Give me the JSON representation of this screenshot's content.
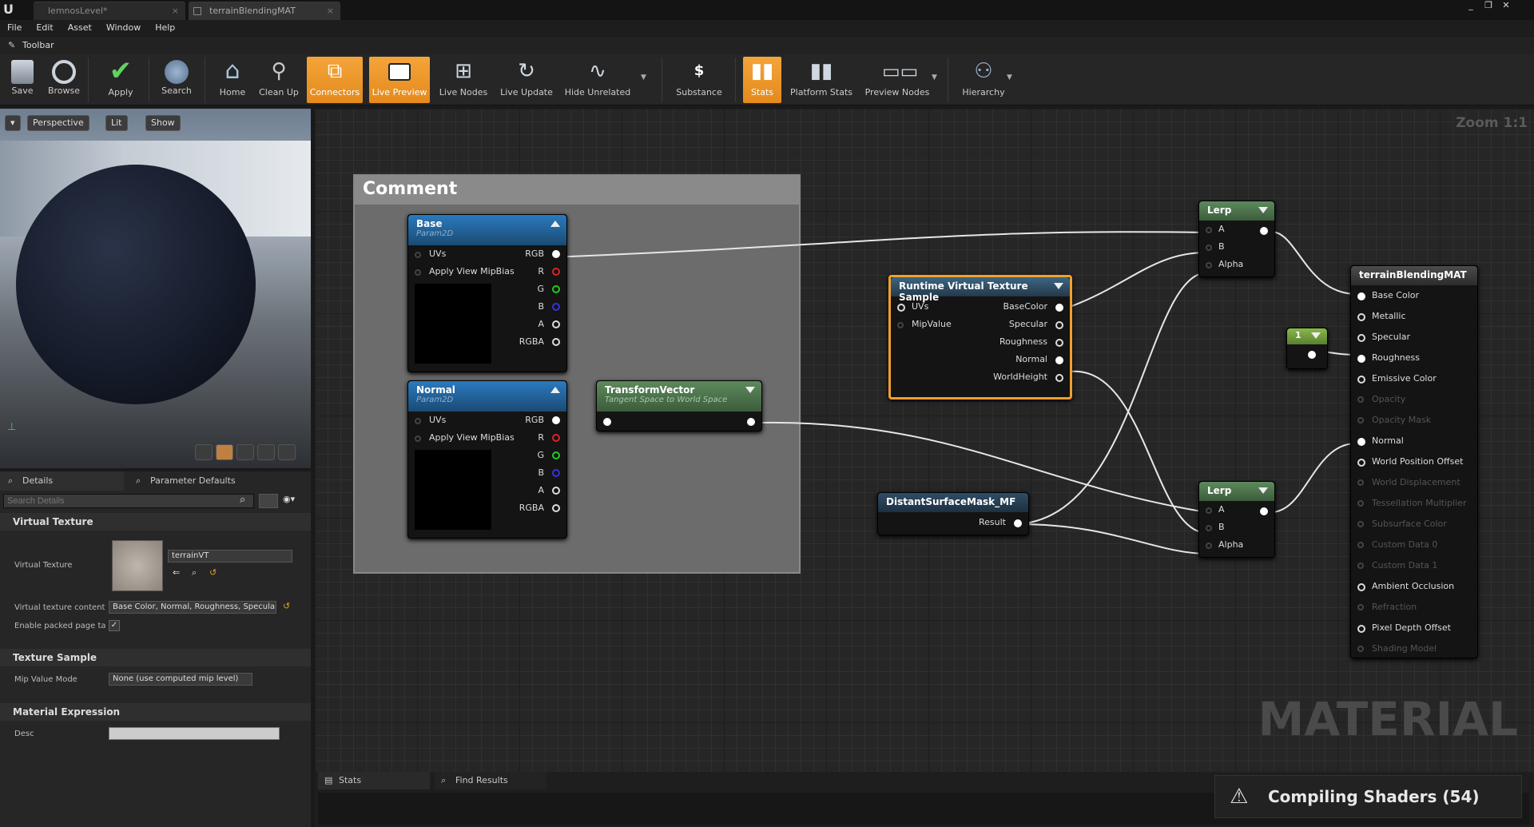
{
  "tabs": [
    {
      "label": "lemnosLevel*"
    },
    {
      "label": "terrainBlendingMAT"
    }
  ],
  "menu": [
    "File",
    "Edit",
    "Asset",
    "Window",
    "Help"
  ],
  "toolbar_title": "Toolbar",
  "toolbar": [
    "Save",
    "Browse",
    "Apply",
    "Search",
    "Home",
    "Clean Up",
    "Connectors",
    "Live Preview",
    "Live Nodes",
    "Live Update",
    "Hide Unrelated",
    "Substance",
    "Stats",
    "Platform Stats",
    "Preview Nodes",
    "Hierarchy"
  ],
  "viewport": {
    "perspective": "Perspective",
    "lit": "Lit",
    "show": "Show"
  },
  "details": {
    "tab_details": "Details",
    "tab_params": "Parameter Defaults",
    "search_placeholder": "Search Details",
    "section_vt": "Virtual Texture",
    "vt_label": "Virtual Texture",
    "vt_value": "terrainVT",
    "vtc_label": "Virtual texture content",
    "vtc_value": "Base Color, Normal, Roughness, Specular",
    "packed_label": "Enable packed page ta",
    "section_ts": "Texture Sample",
    "mip_label": "Mip Value Mode",
    "mip_value": "None (use computed mip level)",
    "section_me": "Material Expression",
    "desc_label": "Desc"
  },
  "graph": {
    "zoom": "Zoom 1:1",
    "watermark": "MATERIAL",
    "comment": "Comment",
    "base": {
      "title": "Base",
      "sub": "Param2D",
      "in": [
        "UVs",
        "Apply View MipBias"
      ],
      "out": [
        "RGB",
        "R",
        "G",
        "B",
        "A",
        "RGBA"
      ]
    },
    "normal": {
      "title": "Normal",
      "sub": "Param2D",
      "in": [
        "UVs",
        "Apply View MipBias"
      ],
      "out": [
        "RGB",
        "R",
        "G",
        "B",
        "A",
        "RGBA"
      ]
    },
    "transform": {
      "title": "TransformVector",
      "sub": "Tangent Space to World Space"
    },
    "rvt": {
      "title": "Runtime Virtual Texture Sample",
      "in": [
        "UVs",
        "MipValue"
      ],
      "out": [
        "BaseColor",
        "Specular",
        "Roughness",
        "Normal",
        "WorldHeight"
      ]
    },
    "mask": {
      "title": "DistantSurfaceMask_MF",
      "out": "Result"
    },
    "lerp1": {
      "title": "Lerp",
      "in": [
        "A",
        "B",
        "Alpha"
      ]
    },
    "lerp2": {
      "title": "Lerp",
      "in": [
        "A",
        "B",
        "Alpha"
      ]
    },
    "const": {
      "value": "1"
    },
    "result": {
      "title": "terrainBlendingMAT",
      "pins": [
        "Base Color",
        "Metallic",
        "Specular",
        "Roughness",
        "Emissive Color",
        "Opacity",
        "Opacity Mask",
        "Normal",
        "World Position Offset",
        "World Displacement",
        "Tessellation Multiplier",
        "Subsurface Color",
        "Custom Data 0",
        "Custom Data 1",
        "Ambient Occlusion",
        "Refraction",
        "Pixel Depth Offset",
        "Shading Model"
      ]
    }
  },
  "bottom": {
    "stats": "Stats",
    "find": "Find Results",
    "compiling": "Compiling Shaders (54)"
  },
  "colors": {
    "accent": "#e48a1c",
    "param_head": "#1b5c8c",
    "green_head": "#4e7a4e",
    "dark_head": "#2d4459"
  }
}
